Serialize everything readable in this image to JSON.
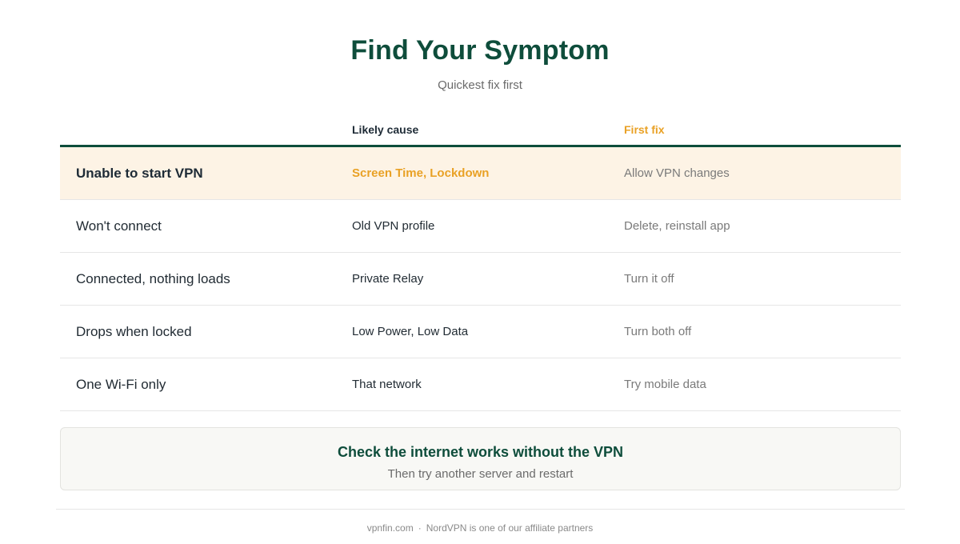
{
  "header": {
    "title": "Find Your Symptom",
    "subtitle": "Quickest fix first"
  },
  "table": {
    "columns": {
      "symptom": "",
      "cause": "Likely cause",
      "fix": "First fix"
    },
    "rows": [
      {
        "symptom": "Unable to start VPN",
        "cause": "Screen Time, Lockdown",
        "fix": "Allow VPN changes",
        "highlighted": true
      },
      {
        "symptom": "Won't connect",
        "cause": "Old VPN profile",
        "fix": "Delete, reinstall app",
        "highlighted": false
      },
      {
        "symptom": "Connected, nothing loads",
        "cause": "Private Relay",
        "fix": "Turn it off",
        "highlighted": false
      },
      {
        "symptom": "Drops when locked",
        "cause": "Low Power, Low Data",
        "fix": "Turn both off",
        "highlighted": false
      },
      {
        "symptom": "One Wi-Fi only",
        "cause": "That network",
        "fix": "Try mobile data",
        "highlighted": false
      }
    ]
  },
  "callout": {
    "title": "Check the internet works without the VPN",
    "subtitle": "Then try another server and restart"
  },
  "footer": {
    "site": "vpnfin.com",
    "separator": "·",
    "disclosure": "NordVPN is one of our affiliate partners"
  },
  "colors": {
    "brand_green": "#0e4d3b",
    "accent_orange": "#e9a125",
    "highlight_bg": "#fdf3e5"
  }
}
